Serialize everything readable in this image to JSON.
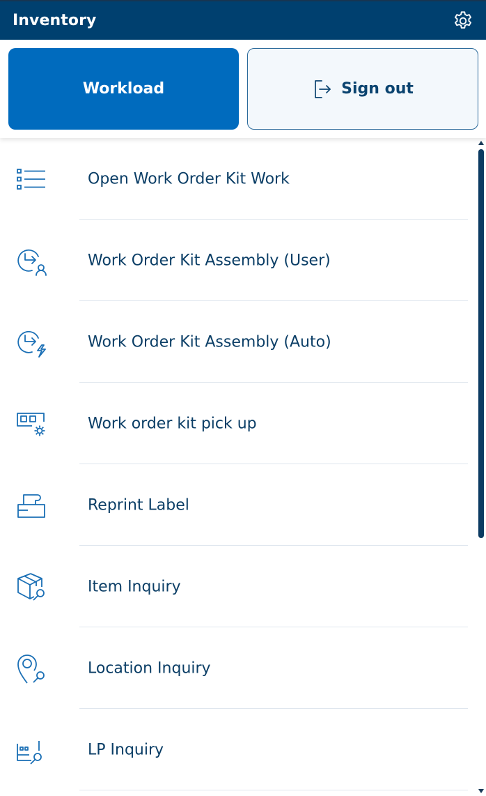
{
  "header": {
    "title": "Inventory",
    "settings_icon": "gear-icon"
  },
  "actions": {
    "workload_label": "Workload",
    "signout_label": "Sign out",
    "signout_icon": "sign-out-icon"
  },
  "colors": {
    "header_bg": "#00406f",
    "primary_button": "#006bbe",
    "secondary_button_bg": "#f3f8fc",
    "text_primary": "#0b3e66",
    "icon_color": "#1a6fb5",
    "divider": "#dfe6ee"
  },
  "menu": {
    "items": [
      {
        "label": "Open Work Order Kit Work",
        "icon": "list-icon"
      },
      {
        "label": "Work Order Kit Assembly (User)",
        "icon": "assembly-user-icon"
      },
      {
        "label": "Work Order Kit Assembly (Auto)",
        "icon": "assembly-auto-icon"
      },
      {
        "label": "Work order kit pick up",
        "icon": "kit-pickup-icon"
      },
      {
        "label": "Reprint Label",
        "icon": "printer-icon"
      },
      {
        "label": "Item Inquiry",
        "icon": "box-search-icon"
      },
      {
        "label": "Location Inquiry",
        "icon": "location-search-icon"
      },
      {
        "label": "LP Inquiry",
        "icon": "license-plate-search-icon"
      }
    ]
  }
}
